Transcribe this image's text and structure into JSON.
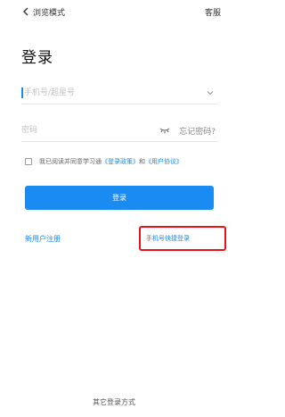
{
  "header": {
    "back_label": "浏览模式",
    "service_label": "客服"
  },
  "title": "登录",
  "phone_field": {
    "placeholder": "手机号/超星号",
    "value": ""
  },
  "password_field": {
    "placeholder": "密码",
    "value": "",
    "forgot_label": "忘记密码?"
  },
  "agreement": {
    "checked": false,
    "prefix": "我已阅读并同意学习通",
    "policy_link": "《登录政策》",
    "conjunction": "和",
    "terms_link": "《用户协议》"
  },
  "login_button_label": "登录",
  "register_label": "新用户注册",
  "quick_login_label": "手机号快捷登录",
  "other_login_label": "其它登录方式",
  "colors": {
    "accent": "#1a8bf0",
    "highlight_border": "#e8131b"
  },
  "icons": {
    "back": "chevron-left-icon",
    "dropdown": "chevron-down-icon",
    "password_visibility": "eye-closed-icon"
  }
}
